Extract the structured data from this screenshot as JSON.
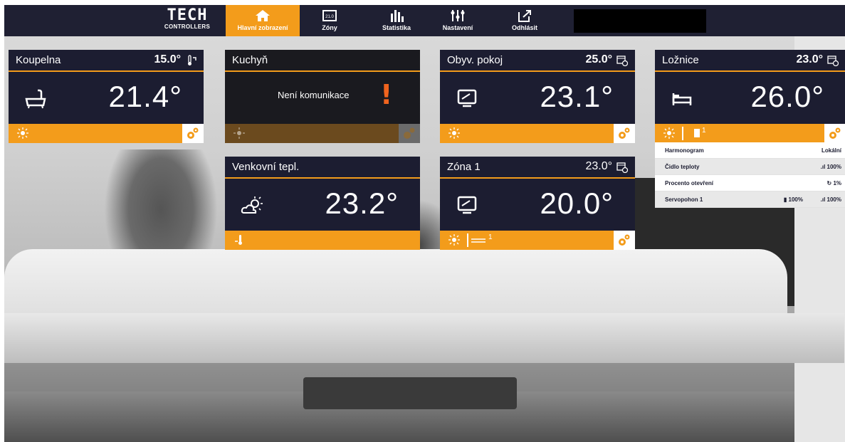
{
  "nav": {
    "logo_top": "TECH",
    "logo_bottom": "CONTROLLERS",
    "items": [
      {
        "label": "Hlavní zobrazení",
        "icon": "home-icon",
        "active": true
      },
      {
        "label": "Zóny",
        "icon": "zones-icon",
        "active": false
      },
      {
        "label": "Statistika",
        "icon": "statistics-icon",
        "active": false
      },
      {
        "label": "Nastavení",
        "icon": "settings-sliders-icon",
        "active": false
      },
      {
        "label": "Odhlásit",
        "icon": "logout-icon",
        "active": false
      }
    ]
  },
  "tiles": [
    {
      "name": "Koupelna",
      "set_temp": "15.0°",
      "temp": "21.4°",
      "icon": "bathtub-icon",
      "header_icon": "thermometer-icon"
    },
    {
      "name": "Kuchyň",
      "message": "Není komunikace",
      "alert": "!"
    },
    {
      "name": "Obyv. pokoj",
      "set_temp": "25.0°",
      "temp": "23.1°",
      "icon": "monitor-icon",
      "header_icon": "calendar-clock-icon"
    },
    {
      "name": "Ložnice",
      "set_temp": "23.0°",
      "temp": "26.0°",
      "icon": "bed-icon",
      "header_icon": "calendar-clock-icon",
      "footer_extra": "1"
    },
    {
      "name": "Venkovní tepl.",
      "temp": "23.2°",
      "icon": "partly-cloudy-icon"
    },
    {
      "name": "Zóna 1",
      "set_temp": "23.0°",
      "temp": "20.0°",
      "icon": "monitor-icon",
      "header_icon": "calendar-clock-icon",
      "footer_extra": "1"
    }
  ],
  "details": {
    "rows": [
      {
        "label": "Harmonogram",
        "value": "Lokální",
        "mid": ""
      },
      {
        "label": "Čidlo teploty",
        "value": "100%",
        "mid": ""
      },
      {
        "label": "Procento otevření",
        "value": "1%",
        "mid": ""
      },
      {
        "label": "Servopohon 1",
        "value": "100%",
        "mid": "100%"
      }
    ]
  },
  "colors": {
    "navy": "#1c1d31",
    "accent": "#f39c1b"
  }
}
